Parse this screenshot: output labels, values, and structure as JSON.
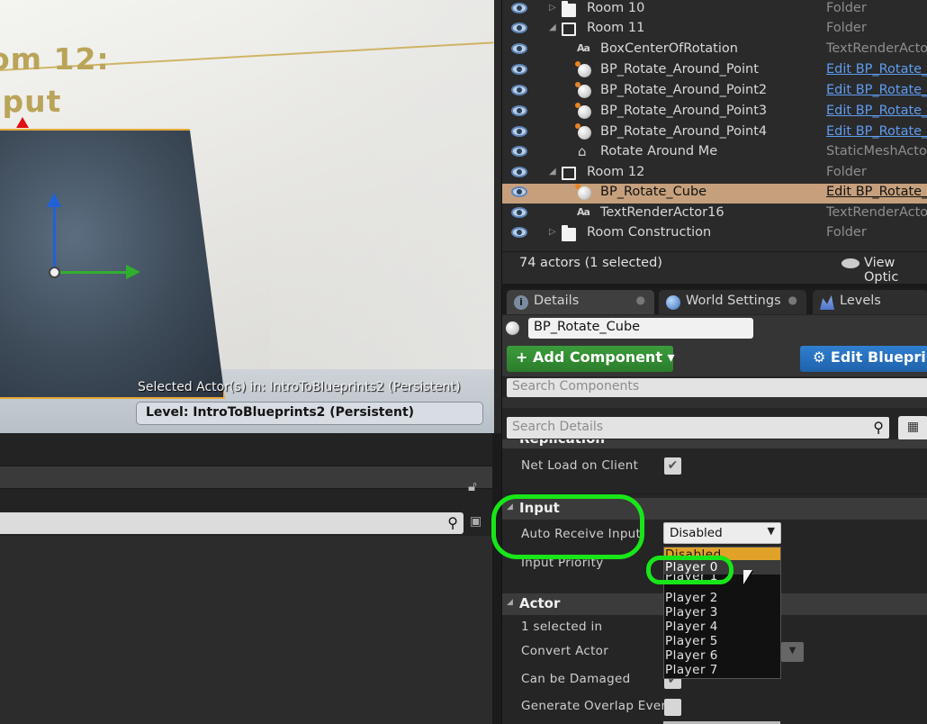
{
  "viewport": {
    "title_line1": "om 12:",
    "title_line2": "nput",
    "selected_actors": "Selected Actor(s) in:  IntroToBlueprints2 (Persistent)",
    "level": "Level:  IntroToBlueprints2 (Persistent)"
  },
  "outliner": {
    "rows": [
      {
        "label": "Room 10",
        "type": "Folder",
        "icon": "folder-icon",
        "link": false
      },
      {
        "label": "Room 11",
        "type": "Folder",
        "icon": "folder-open-icon",
        "link": false
      },
      {
        "label": "BoxCenterOfRotation",
        "type": "TextRenderActor",
        "icon": "text-render-icon",
        "link": false
      },
      {
        "label": "BP_Rotate_Around_Point",
        "type": "Edit BP_Rotate_",
        "icon": "blueprint-sphere-icon",
        "link": true
      },
      {
        "label": "BP_Rotate_Around_Point2",
        "type": "Edit BP_Rotate_",
        "icon": "blueprint-sphere-icon",
        "link": true
      },
      {
        "label": "BP_Rotate_Around_Point3",
        "type": "Edit BP_Rotate_",
        "icon": "blueprint-sphere-icon",
        "link": true
      },
      {
        "label": "BP_Rotate_Around_Point4",
        "type": "Edit BP_Rotate_",
        "icon": "blueprint-sphere-icon",
        "link": true
      },
      {
        "label": "Rotate Around Me",
        "type": "StaticMeshActor",
        "icon": "static-mesh-icon",
        "link": false
      },
      {
        "label": "Room 12",
        "type": "Folder",
        "icon": "folder-open-icon",
        "link": false
      },
      {
        "label": "BP_Rotate_Cube",
        "type": "Edit BP_Rotate_",
        "icon": "blueprint-sphere-icon",
        "link": true
      },
      {
        "label": "TextRenderActor16",
        "type": "TextRenderActor",
        "icon": "text-render-icon",
        "link": false
      },
      {
        "label": "Room Construction",
        "type": "Folder",
        "icon": "folder-icon",
        "link": false
      }
    ],
    "actor_count": "74 actors (1 selected)",
    "view_options": "View Optic"
  },
  "details": {
    "tabs": {
      "details": "Details",
      "world_settings": "World Settings",
      "levels": "Levels"
    },
    "name": "BP_Rotate_Cube",
    "add_component": "+ Add Component",
    "edit_blueprint": "Edit Blueprin",
    "search_components_placeholder": "Search Components",
    "search_details_placeholder": "Search Details",
    "replication": {
      "label": "Replication",
      "net_load_on_client": "Net Load on Client",
      "net_load_checked": true
    },
    "input": {
      "label": "Input",
      "auto_receive_input": "Auto Receive Input",
      "auto_receive_value": "Disabled",
      "input_priority": "Input Priority",
      "options": [
        "Disabled",
        "Player 0",
        "Player 1",
        "Player 2",
        "Player 3",
        "Player 4",
        "Player 5",
        "Player 6",
        "Player 7"
      ]
    },
    "actor": {
      "label": "Actor",
      "selected_in": "1 selected in",
      "convert_actor": "Convert Actor",
      "can_be_damaged": "Can be Damaged",
      "generate_overlap": "Generate Overlap Event"
    }
  },
  "colors": {
    "annotation": "#19e619",
    "selection": "#c6a07c",
    "dropdown_highlight": "#e0a228"
  }
}
